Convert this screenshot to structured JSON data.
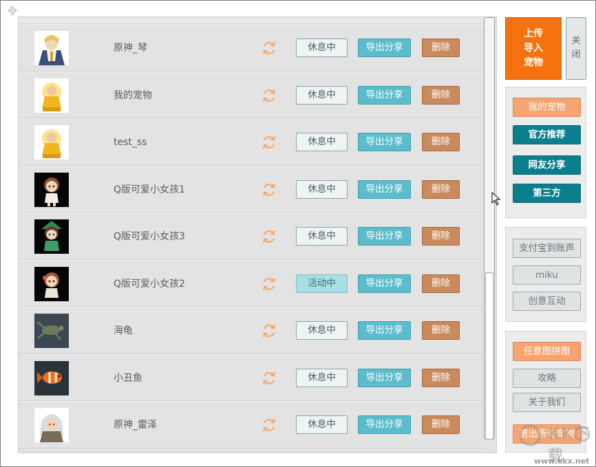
{
  "pets": [
    {
      "name": "原神_琴",
      "status": "休息中",
      "status_active": false,
      "export_label": "导出分享",
      "delete_label": "删除"
    },
    {
      "name": "我的宠物",
      "status": "休息中",
      "status_active": false,
      "export_label": "导出分享",
      "delete_label": "删除"
    },
    {
      "name": "test_ss",
      "status": "休息中",
      "status_active": false,
      "export_label": "导出分享",
      "delete_label": "删除"
    },
    {
      "name": "Q版可爱小女孩1",
      "status": "休息中",
      "status_active": false,
      "export_label": "导出分享",
      "delete_label": "删除"
    },
    {
      "name": "Q版可爱小女孩3",
      "status": "休息中",
      "status_active": false,
      "export_label": "导出分享",
      "delete_label": "删除"
    },
    {
      "name": "Q版可爱小女孩2",
      "status": "活动中",
      "status_active": true,
      "export_label": "导出分享",
      "delete_label": "删除"
    },
    {
      "name": "海龟",
      "status": "休息中",
      "status_active": false,
      "export_label": "导出分享",
      "delete_label": "删除"
    },
    {
      "name": "小丑鱼",
      "status": "休息中",
      "status_active": false,
      "export_label": "导出分享",
      "delete_label": "删除"
    },
    {
      "name": "原神_雷泽",
      "status": "休息中",
      "status_active": false,
      "export_label": "导出分享",
      "delete_label": "删除"
    }
  ],
  "sidebar": {
    "upload_line1": "上传",
    "upload_line2": "导入",
    "upload_line3": "宠物",
    "close_line1": "关",
    "close_line2": "闭",
    "nav": {
      "my_pets": "我的宠物",
      "official": "官方推荐",
      "community": "网友分享",
      "third_party": "第三方"
    },
    "extras": {
      "alipay": "支付宝到账声",
      "miku": "miku",
      "creative": "创意互动"
    },
    "misc": {
      "puzzle": "任意图拼图",
      "guide": "攻略",
      "about": "关于我们",
      "exit_all": "退出所有宠物"
    }
  },
  "watermark": {
    "text": "KK下载",
    "url": "www.kkx.net"
  },
  "colors": {
    "upload": "#f5720f",
    "teal": "#0c7f8e",
    "export": "#5cbccb",
    "delete": "#c98a5e",
    "active_status": "#a8dfe4",
    "refresh_icon": "#f7a866"
  },
  "icons": {
    "move": "move-icon",
    "refresh": "refresh-icon",
    "cursor": "cursor-icon"
  }
}
